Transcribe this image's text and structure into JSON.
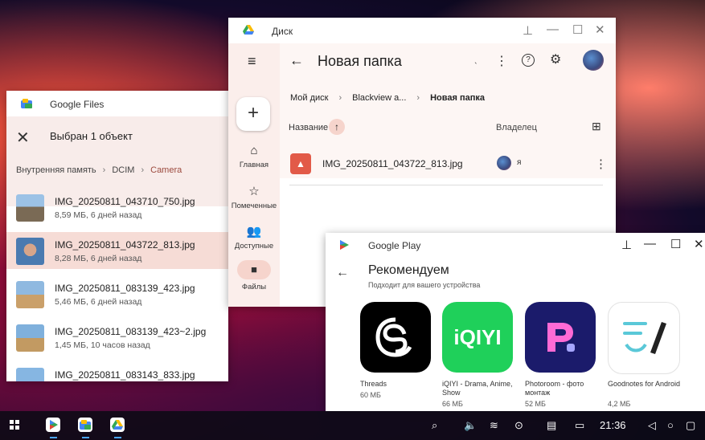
{
  "files": {
    "title": "Google Files",
    "selection_text": "Выбран 1 объект",
    "breadcrumbs": [
      "Внутренняя память",
      "DCIM",
      "Camera"
    ],
    "items": [
      {
        "name": "IMG_20250811_043710_750.jpg",
        "meta": "8,59 МБ, 6 дней назад",
        "selected": false
      },
      {
        "name": "IMG_20250811_043722_813.jpg",
        "meta": "8,28 МБ, 6 дней назад",
        "selected": true
      },
      {
        "name": "IMG_20250811_083139_423.jpg",
        "meta": "5,46 МБ, 6 дней назад",
        "selected": false
      },
      {
        "name": "IMG_20250811_083139_423~2.jpg",
        "meta": "1,45 МБ, 10 часов назад",
        "selected": false
      },
      {
        "name": "IMG_20250811_083143_833.jpg",
        "meta": "",
        "selected": false
      }
    ]
  },
  "drive": {
    "title": "Диск",
    "folder_title": "Новая папка",
    "breadcrumbs": [
      "Мой диск",
      "Blackview a...",
      "Новая папка"
    ],
    "col_name": "Название",
    "col_owner": "Владелец",
    "file": {
      "name": "IMG_20250811_043722_813.jpg",
      "owner": "я"
    },
    "nav": [
      {
        "label": "Главная"
      },
      {
        "label": "Помеченные"
      },
      {
        "label": "Доступные"
      },
      {
        "label": "Файлы"
      }
    ],
    "stray_mark": "ˎ"
  },
  "play": {
    "title": "Google Play",
    "heading": "Рекомендуем",
    "subheading": "Подходит для вашего устройства",
    "apps": [
      {
        "name": "Threads",
        "size": "60 МБ"
      },
      {
        "name": "iQIYI - Drama, Anime, Show",
        "size": "66 МБ"
      },
      {
        "name": "Photoroom - фото монтаж",
        "size": "52 МБ"
      },
      {
        "name": "Goodnotes for Android",
        "size": "4,2 МБ"
      }
    ],
    "iqiyi_logo": "iQIYI"
  },
  "taskbar": {
    "time": "21:36"
  },
  "colors": {
    "accent": "#9c4a3e",
    "selection": "#f6dcd6",
    "drive_tint": "#fbeeeb",
    "threads_bg": "#000000",
    "iqiyi_bg": "#1fd05a",
    "photoroom_bg": "#1b1b6b"
  }
}
